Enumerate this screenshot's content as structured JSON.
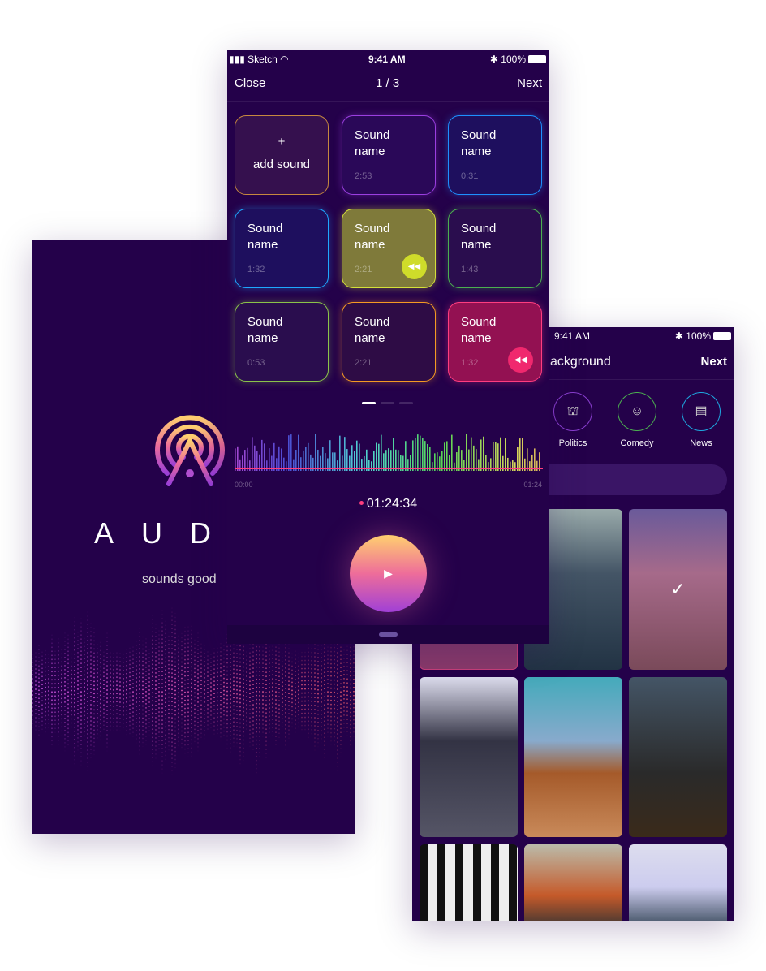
{
  "splash": {
    "brand": "AUD",
    "tagline": "sounds good"
  },
  "sound_screen": {
    "status": {
      "carrier": "Sketch",
      "time": "9:41 AM",
      "battery": "100%"
    },
    "nav": {
      "close": "Close",
      "page": "1 / 3",
      "next": "Next"
    },
    "add_sound": {
      "icon": "+",
      "label": "add sound"
    },
    "tiles": [
      {
        "name": "Sound name",
        "time": "2:53",
        "color": "#9b3fe0",
        "fill": "#2a0858"
      },
      {
        "name": "Sound name",
        "time": "0:31",
        "color": "#1e90ff",
        "fill": "#1e0f5e"
      },
      {
        "name": "Sound name",
        "time": "1:32",
        "color": "#1ea8ff",
        "fill": "#1e0f5e"
      },
      {
        "name": "Sound name",
        "time": "2:21",
        "color": "#d4e03a",
        "fill": "#7f7a3a",
        "active": true,
        "button": "#cfdc2a"
      },
      {
        "name": "Sound name",
        "time": "1:43",
        "color": "#4caf50",
        "fill": "#2a0d4e"
      },
      {
        "name": "Sound name",
        "time": "0:53",
        "color": "#8bc34a",
        "fill": "#2a0d4e"
      },
      {
        "name": "Sound name",
        "time": "2:21",
        "color": "#f59a23",
        "fill": "#2e0c45"
      },
      {
        "name": "Sound name",
        "time": "1:32",
        "color": "#ff3d7f",
        "fill": "#931152",
        "active": true,
        "button": "#f0286e"
      }
    ],
    "page_dots": 3,
    "active_dot": 0,
    "wave_start": "00:00",
    "wave_end": "01:24",
    "timer": "01:24:34",
    "play_icon": "play-icon"
  },
  "background_screen": {
    "status": {
      "time": "9:41 AM",
      "battery": "100%"
    },
    "title": "ackground",
    "next": "Next",
    "categories": [
      {
        "label": "Politics",
        "icon": "podium-icon",
        "glyph": "⛫",
        "color": "#8a3fd0"
      },
      {
        "label": "Comedy",
        "icon": "smile-icon",
        "glyph": "☺",
        "color": "#4caf50"
      },
      {
        "label": "News",
        "icon": "newspaper-icon",
        "glyph": "▤",
        "color": "#1ea8e0"
      }
    ],
    "selected_image": 1,
    "check_icon": "✓"
  }
}
